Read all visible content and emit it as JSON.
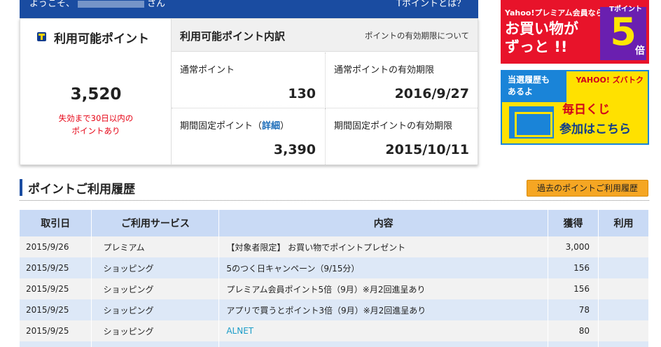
{
  "header": {
    "welcome_prefix": "ようこそ、",
    "welcome_suffix": "さん",
    "about_tpoint": "Tポイントとは？"
  },
  "points": {
    "available_label": "利用可能ポイント",
    "available_value": "3,520",
    "expire_warning_line1": "失効まで30日以内の",
    "expire_warning_line2": "ポイントあり",
    "breakdown_title": "利用可能ポイント内訳",
    "expiry_info_link": "ポイントの有効期限について",
    "normal_label": "通常ポイント",
    "normal_value": "130",
    "normal_expiry_label": "通常ポイントの有効期限",
    "normal_expiry_value": "2016/9/27",
    "fixed_label": "期間固定ポイント（",
    "fixed_detail_link": "詳細",
    "fixed_label_end": "）",
    "fixed_value": "3,390",
    "fixed_expiry_label": "期間固定ポイントの有効期限",
    "fixed_expiry_value": "2015/10/11"
  },
  "banners": {
    "premium": {
      "small": "Yahoo!プレミアム会員なら",
      "big_line1": "お買い物が",
      "big_line2": "ずっと !!",
      "tpoint": "Tポイント",
      "five": "5",
      "times": "倍"
    },
    "kuji": {
      "hist_line1": "当選履歴も",
      "hist_line2": "あるよ",
      "yahoo": "YAHOO! ズバトク",
      "kuji": "毎日くじ",
      "join": "参加はこちら"
    }
  },
  "history": {
    "title": "ポイントご利用履歴",
    "past_button": "過去のポイントご利用履歴",
    "columns": [
      "取引日",
      "ご利用サービス",
      "内容",
      "獲得",
      "利用"
    ],
    "rows": [
      {
        "date": "2015/9/26",
        "service": "プレミアム",
        "content": "【対象者限定】 お買い物でポイントプレゼント",
        "earned": "3,000",
        "used": ""
      },
      {
        "date": "2015/9/25",
        "service": "ショッピング",
        "content": "5のつく日キャンペーン（9/15分）",
        "earned": "156",
        "used": ""
      },
      {
        "date": "2015/9/25",
        "service": "ショッピング",
        "content": "プレミアム会員ポイント5倍（9月）※月2回進呈あり",
        "earned": "156",
        "used": ""
      },
      {
        "date": "2015/9/25",
        "service": "ショッピング",
        "content": "アプリで買うとポイント3倍（9月）※月2回進呈あり",
        "earned": "78",
        "used": ""
      },
      {
        "date": "2015/9/25",
        "service": "ショッピング",
        "content": "ALNET",
        "earned": "80",
        "used": ""
      }
    ]
  }
}
